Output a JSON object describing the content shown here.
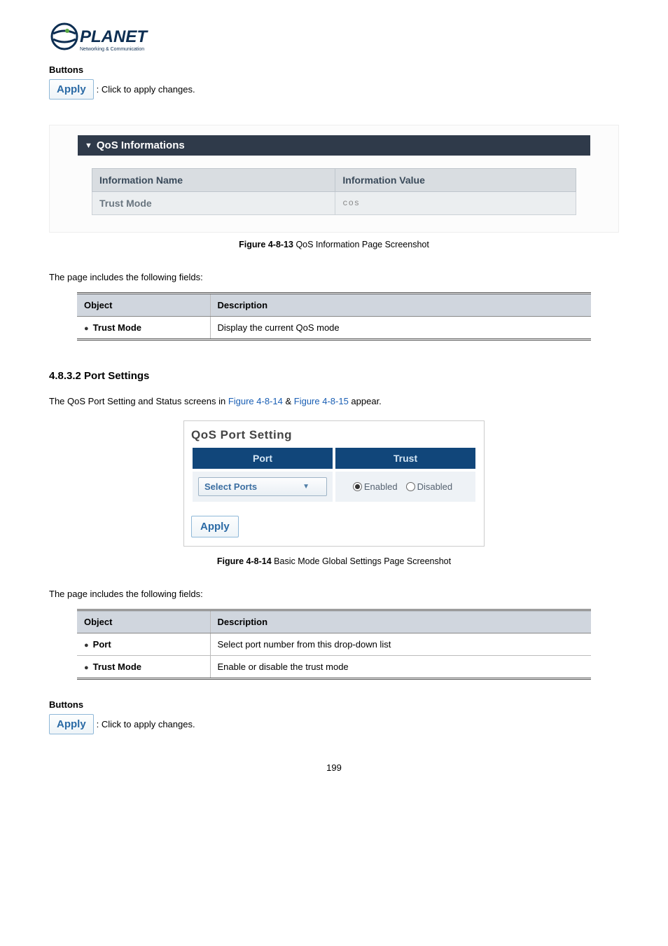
{
  "logo": {
    "brand": "PLANET",
    "tagline": "Networking & Communication"
  },
  "buttons1": {
    "label": "Buttons",
    "apply_label": "Apply",
    "apply_desc": ": Click to apply changes."
  },
  "qos_info_panel": {
    "title": "QoS Informations",
    "col_name": "Information Name",
    "col_value": "Information Value",
    "row_name": "Trust Mode",
    "row_value": "cos"
  },
  "figure1": {
    "bold": "Figure 4-8-13",
    "rest": " QoS Information Page Screenshot"
  },
  "fields_intro": "The page includes the following fields:",
  "table1": {
    "h_object": "Object",
    "h_desc": "Description",
    "r1_obj": "Trust Mode",
    "r1_desc": "Display the current QoS mode"
  },
  "subsection": "4.8.3.2 Port Settings",
  "intro2": {
    "pre": "The QoS Port Setting and Status screens in ",
    "link1": "Figure 4-8-14",
    "mid": " & ",
    "link2": "Figure 4-8-15",
    "post": " appear."
  },
  "qos_port": {
    "title": "QoS Port Setting",
    "h_port": "Port",
    "h_trust": "Trust",
    "select_label": "Select Ports",
    "opt_enabled": "Enabled",
    "opt_disabled": "Disabled",
    "apply_label": "Apply"
  },
  "figure2": {
    "bold": "Figure 4-8-14",
    "rest": " Basic Mode Global Settings Page Screenshot"
  },
  "fields_intro2": "The page includes the following fields:",
  "table2": {
    "h_object": "Object",
    "h_desc": "Description",
    "r1_obj": "Port",
    "r1_desc": "Select port number from this drop-down list",
    "r2_obj": "Trust Mode",
    "r2_desc": "Enable or disable the trust mode"
  },
  "buttons2": {
    "label": "Buttons",
    "apply_label": "Apply",
    "apply_desc": ": Click to apply changes."
  },
  "page_number": "199"
}
